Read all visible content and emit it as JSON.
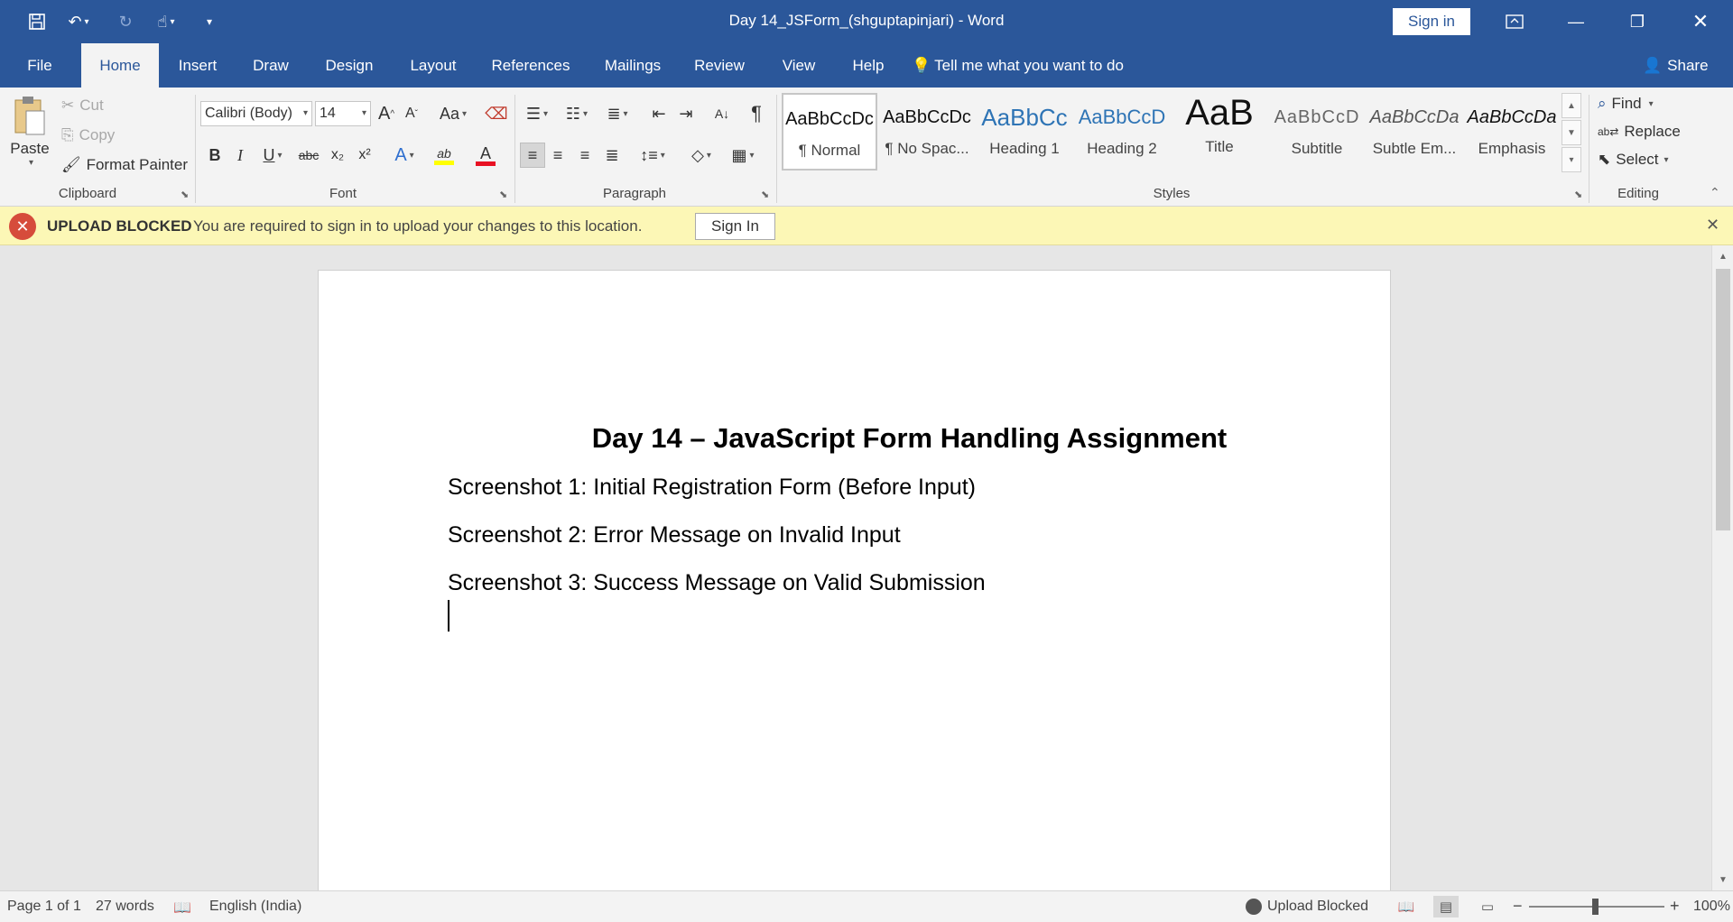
{
  "window": {
    "title": "Day 14_JSForm_(shguptapinjari)  -  Word",
    "signin_label": "Sign in",
    "quick_access": [
      "save-icon",
      "undo-icon",
      "redo-icon",
      "touch-mode-icon",
      "customize-icon"
    ],
    "controls": [
      "ribbon-display-icon",
      "minimize-icon",
      "restore-icon",
      "close-icon"
    ]
  },
  "tabs": [
    {
      "label": "File"
    },
    {
      "label": "Home"
    },
    {
      "label": "Insert"
    },
    {
      "label": "Draw"
    },
    {
      "label": "Design"
    },
    {
      "label": "Layout"
    },
    {
      "label": "References"
    },
    {
      "label": "Mailings"
    },
    {
      "label": "Review"
    },
    {
      "label": "View"
    },
    {
      "label": "Help"
    }
  ],
  "active_tab": "Home",
  "tell_me": "Tell me what you want to do",
  "share": "Share",
  "clipboard": {
    "label": "Clipboard",
    "paste": "Paste",
    "cut": "Cut",
    "copy": "Copy",
    "format_painter": "Format Painter"
  },
  "font": {
    "label": "Font",
    "family": "Calibri (Body)",
    "size": "14",
    "grow_glyph": "A",
    "shrink_glyph": "A",
    "case_glyph": "Aa",
    "bold": "B",
    "italic": "I",
    "underline": "U",
    "strike": "abc",
    "subscript": "x₂",
    "superscript": "x²",
    "effects_glyph": "A",
    "highlight_glyph": "ab",
    "color_glyph": "A",
    "highlight_color": "#ffff00",
    "font_color": "#e81123"
  },
  "paragraph": {
    "label": "Paragraph",
    "pilcrow": "¶"
  },
  "styles": {
    "label": "Styles",
    "items": [
      {
        "preview": "AaBbCcDc",
        "name": "¶ Normal"
      },
      {
        "preview": "AaBbCcDc",
        "name": "¶ No Spac..."
      },
      {
        "preview": "AaBbCc",
        "name": "Heading 1"
      },
      {
        "preview": "AaBbCcD",
        "name": "Heading 2"
      },
      {
        "preview": "AaB",
        "name": "Title"
      },
      {
        "preview": "AaBbCcD",
        "name": "Subtitle"
      },
      {
        "preview": "AaBbCcDa",
        "name": "Subtle Em..."
      },
      {
        "preview": "AaBbCcDa",
        "name": "Emphasis"
      }
    ],
    "selected": "¶ Normal"
  },
  "editing": {
    "label": "Editing",
    "find": "Find",
    "replace": "Replace",
    "select": "Select"
  },
  "message_bar": {
    "heading": "UPLOAD BLOCKED",
    "text": "You are required to sign in to upload your changes to this location.",
    "button": "Sign In"
  },
  "document": {
    "title": "Day 14 – JavaScript Form Handling Assignment",
    "paragraphs": [
      "Screenshot 1: Initial Registration Form (Before Input)",
      "Screenshot 2: Error Message on Invalid Input",
      "Screenshot 3: Success Message on Valid Submission"
    ]
  },
  "status": {
    "page": "Page 1 of 1",
    "words": "27 words",
    "language": "English (India)",
    "upload": "Upload Blocked",
    "zoom_minus": "−",
    "zoom_plus": "+",
    "zoom": "100%"
  },
  "colors": {
    "accent": "#2b579a",
    "message_bar": "#fcf7b6",
    "error": "#d64c3b"
  }
}
